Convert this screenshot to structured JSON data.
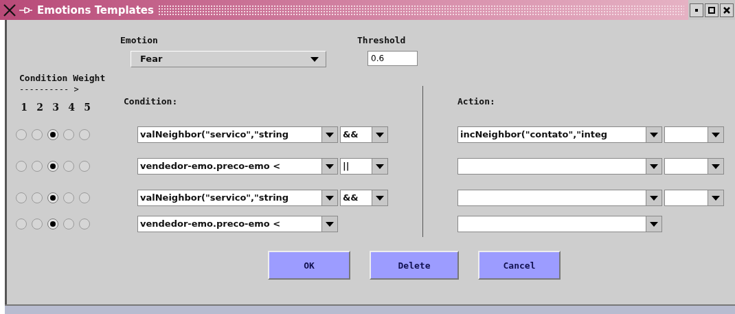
{
  "window": {
    "title": "Emotions Templates"
  },
  "emotion": {
    "label": "Emotion",
    "value": "Fear"
  },
  "threshold": {
    "label": "Threshold",
    "value": "0.6"
  },
  "weight_header": {
    "title": "Condition Weight",
    "arrow": "---------- >",
    "numbers": [
      "1",
      "2",
      "3",
      "4",
      "5"
    ]
  },
  "condition_label": "Condition:",
  "action_label": "Action:",
  "rows": [
    {
      "weights": [
        {
          "selected": false
        },
        {
          "selected": false
        },
        {
          "selected": true
        },
        {
          "selected": false
        },
        {
          "selected": false
        }
      ],
      "condition": {
        "kind": "with_operator",
        "value": "valNeighbor(\"servico\",\"string",
        "operator": "&&"
      },
      "action": {
        "kind": "with_operator",
        "value": "incNeighbor(\"contato\",\"integ"
      }
    },
    {
      "weights": [
        {
          "selected": false
        },
        {
          "selected": false
        },
        {
          "selected": true
        },
        {
          "selected": false
        },
        {
          "selected": false
        }
      ],
      "condition": {
        "kind": "with_operator",
        "value": "vendedor-emo.preco-emo <",
        "operator": "||"
      },
      "action": {
        "kind": "with_operator"
      }
    },
    {
      "weights": [
        {
          "selected": false
        },
        {
          "selected": false
        },
        {
          "selected": true
        },
        {
          "selected": false
        },
        {
          "selected": false
        }
      ],
      "condition": {
        "kind": "with_operator",
        "value": "valNeighbor(\"servico\",\"string",
        "operator": "&&"
      },
      "action": {
        "kind": "with_operator"
      }
    },
    {
      "weights": [
        {
          "selected": false
        },
        {
          "selected": false
        },
        {
          "selected": true
        },
        {
          "selected": false
        },
        {
          "selected": false
        }
      ],
      "condition": {
        "kind": "single",
        "value": "vendedor-emo.preco-emo <"
      },
      "action": {
        "kind": "single"
      }
    }
  ],
  "buttons": [
    "OK",
    "Delete",
    "Cancel"
  ]
}
